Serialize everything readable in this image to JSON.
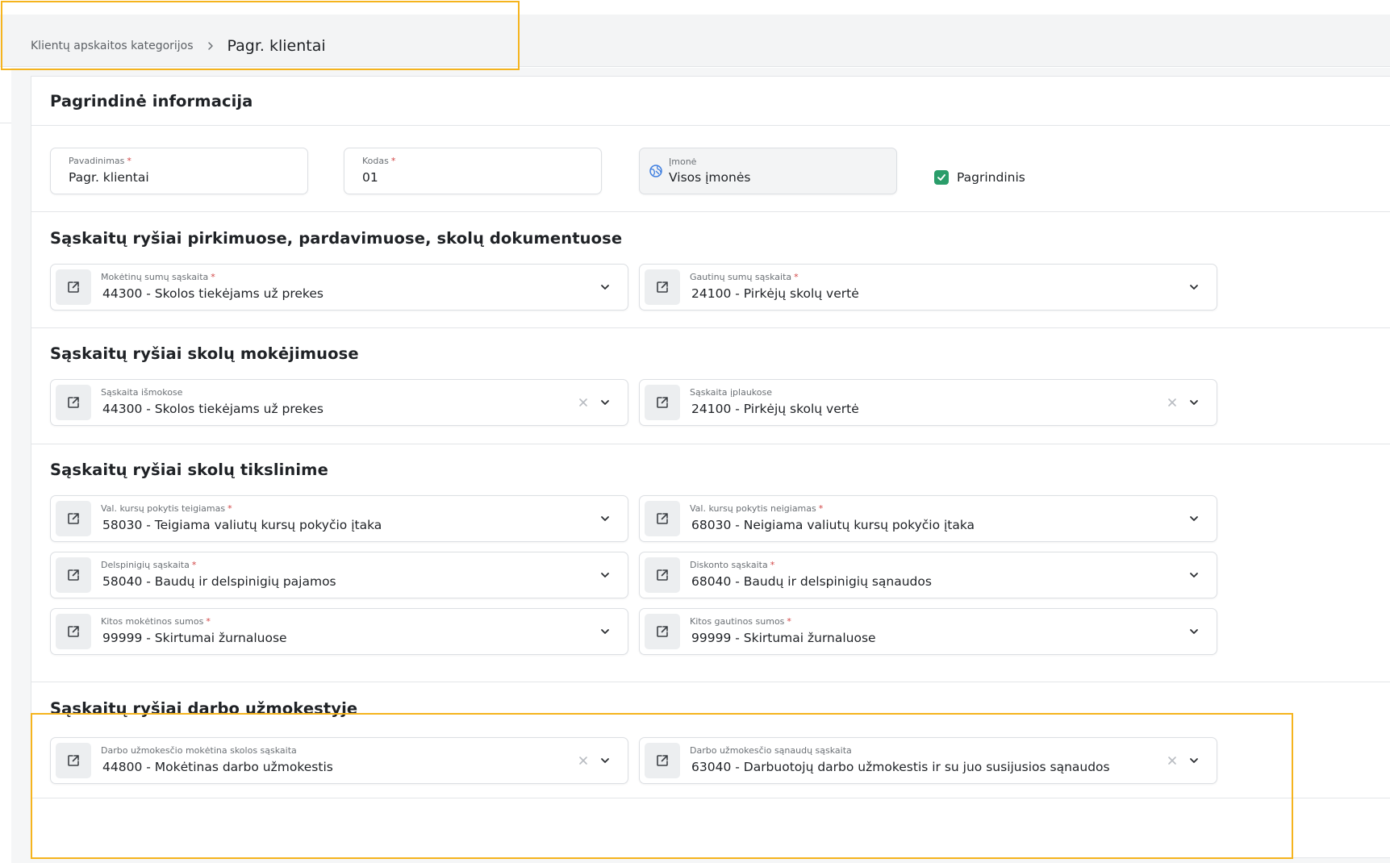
{
  "breadcrumb": {
    "parent": "Klientų apskaitos kategorijos",
    "current": "Pagr. klientai"
  },
  "basic_info": {
    "title": "Pagrindinė informacija",
    "name": {
      "label": "Pavadinimas",
      "required": "*",
      "value": "Pagr. klientai"
    },
    "code": {
      "label": "Kodas",
      "required": "*",
      "value": "01"
    },
    "company": {
      "label": "Įmonė",
      "value": "Visos įmonės",
      "icon": "globe-icon"
    },
    "main_checkbox": {
      "label": "Pagrindinis",
      "checked": true
    }
  },
  "sections": {
    "purchases": {
      "title": "Sąskaitų ryšiai pirkimuose, pardavimuose, skolų dokumentuose",
      "left": {
        "label": "Mokėtinų sumų sąskaita",
        "required": "*",
        "value": "44300 - Skolos tiekėjams už prekes"
      },
      "right": {
        "label": "Gautinų sumų sąskaita",
        "required": "*",
        "value": "24100 - Pirkėjų skolų vertė"
      }
    },
    "payments": {
      "title": "Sąskaitų ryšiai skolų mokėjimuose",
      "left": {
        "label": "Sąskaita išmokose",
        "value": "44300 - Skolos tiekėjams už prekes"
      },
      "right": {
        "label": "Sąskaita įplaukose",
        "value": "24100 - Pirkėjų skolų vertė"
      }
    },
    "adjustment": {
      "title": "Sąskaitų ryšiai skolų tikslinime",
      "row1_left": {
        "label": "Val. kursų pokytis teigiamas",
        "required": "*",
        "value": "58030 - Teigiama valiutų kursų pokyčio įtaka"
      },
      "row1_right": {
        "label": "Val. kursų pokytis neigiamas",
        "required": "*",
        "value": "68030 - Neigiama valiutų kursų pokyčio įtaka"
      },
      "row2_left": {
        "label": "Delspinigių sąskaita",
        "required": "*",
        "value": "58040 - Baudų ir delspinigių pajamos"
      },
      "row2_right": {
        "label": "Diskonto sąskaita",
        "required": "*",
        "value": "68040 - Baudų ir delspinigių sąnaudos"
      },
      "row3_left": {
        "label": "Kitos mokėtinos sumos",
        "required": "*",
        "value": "99999 - Skirtumai žurnaluose"
      },
      "row3_right": {
        "label": "Kitos gautinos sumos",
        "required": "*",
        "value": "99999 - Skirtumai žurnaluose"
      }
    },
    "payroll": {
      "title": "Sąskaitų ryšiai darbo užmokestyje",
      "left": {
        "label": "Darbo užmokesčio mokėtina skolos sąskaita",
        "value": "44800 - Mokėtinas darbo užmokestis"
      },
      "right": {
        "label": "Darbo užmokesčio sąnaudų sąskaita",
        "value": "63040 - Darbuotojų darbo užmokestis ir su juo susijusios sąnaudos"
      }
    }
  },
  "icons": {
    "link": "external-link-icon",
    "chevron": "chevron-down-icon",
    "clear": "close-icon",
    "separator": "chevron-right-icon"
  },
  "colors": {
    "highlight": "#f5b41e",
    "checkbox": "#2a9d6a",
    "required": "#d24545"
  }
}
